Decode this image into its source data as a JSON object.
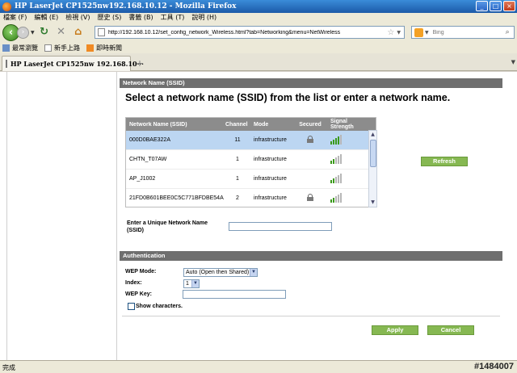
{
  "window": {
    "title": "HP LaserJet CP1525nw192.168.10.12 - Mozilla Firefox",
    "buttons": {
      "minimize": "_",
      "maximize": "□",
      "close": "×"
    }
  },
  "menu": [
    "檔案 (F)",
    "編輯 (E)",
    "檢視 (V)",
    "歷史 (S)",
    "書籤 (B)",
    "工具 (T)",
    "說明 (H)"
  ],
  "nav": {
    "url": "http://192.168.10.12/set_config_network_Wireless.html?tab=Networking&menu=NetWireless",
    "search_placeholder": "Bing"
  },
  "bookmarks": [
    "最常瀏覽",
    "新手上路",
    "即時新聞"
  ],
  "tab": {
    "label": "HP LaserJet CP1525nw    192.168.10···",
    "new": "+"
  },
  "page": {
    "ssid_header": "Network Name (SSID)",
    "ssid_subtitle": "Select a network name (SSID) from the list or enter a network name.",
    "table": {
      "headers": {
        "name": "Network Name (SSID)",
        "channel": "Channel",
        "mode": "Mode",
        "secured": "Secured",
        "signal": "Signal Strength"
      },
      "rows": [
        {
          "name": "000D0BAE322A",
          "channel": "11",
          "mode": "infrastructure",
          "secured": true,
          "signal": 4,
          "selected": true
        },
        {
          "name": "CHTN_T07AW",
          "channel": "1",
          "mode": "infrastructure",
          "secured": false,
          "signal": 2,
          "selected": false
        },
        {
          "name": "AP_J1002",
          "channel": "1",
          "mode": "infrastructure",
          "secured": false,
          "signal": 2,
          "selected": false
        },
        {
          "name": "21FD0B601BEE0C5C771BFDBE54AB3A19",
          "channel": "2",
          "mode": "infrastructure",
          "secured": true,
          "signal": 2,
          "selected": false
        }
      ]
    },
    "refresh_label": "Refresh",
    "unique_name_label": "Enter a Unique Network Name (SSID)",
    "unique_name_value": "",
    "auth_header": "Authentication",
    "wep_mode_label": "WEP Mode:",
    "wep_mode_value": "Auto (Open then Shared)",
    "index_label": "Index:",
    "index_value": "1",
    "wep_key_label": "WEP Key:",
    "wep_key_value": "",
    "show_chars_label": "Show characters.",
    "apply_label": "Apply",
    "cancel_label": "Cancel"
  },
  "status": {
    "text": "完成",
    "watermark": "#1484007"
  },
  "colors": {
    "accent_green": "#86b852",
    "header_gray": "#6f6f6f",
    "selected_row": "#bcd6f2",
    "signal_green": "#3a9a1a"
  }
}
